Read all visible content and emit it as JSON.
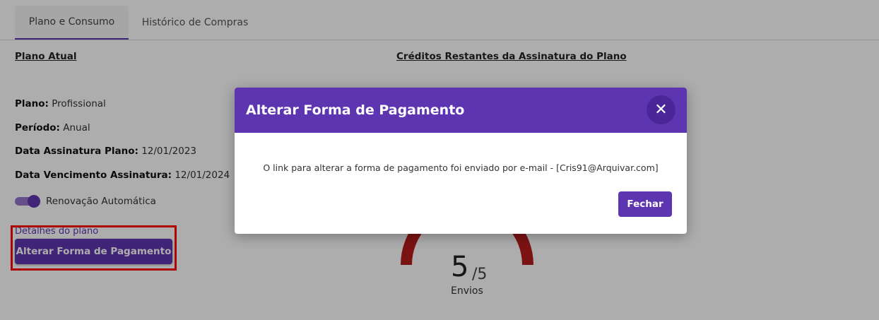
{
  "tabs": [
    {
      "label": "Plano e Consumo",
      "active": true
    },
    {
      "label": "Histórico de Compras",
      "active": false
    }
  ],
  "plan": {
    "heading": "Plano Atual",
    "fields": [
      {
        "label": "Plano:",
        "value": "Profissional"
      },
      {
        "label": "Período:",
        "value": "Anual"
      },
      {
        "label": "Data Assinatura Plano:",
        "value": "12/01/2023"
      },
      {
        "label": "Data Vencimento Assinatura:",
        "value": "12/01/2024"
      }
    ],
    "auto_renew": {
      "label": "Renovação Automática",
      "enabled": true
    },
    "details_link": "Detalhes do plano",
    "change_payment_button": "Alterar Forma de Pagamento"
  },
  "credits": {
    "heading": "Créditos Restantes da Assinatura do Plano",
    "remaining": "5",
    "total": "/5",
    "unit": "Envios"
  },
  "modal": {
    "title": "Alterar Forma de Pagamento",
    "close_icon": "close-icon",
    "message": "O link para alterar a forma de pagamento foi enviado por e-mail - [Cris91@Arquivar.com]",
    "button": "Fechar"
  },
  "colors": {
    "primary": "#5e35b1",
    "highlight": "#ff0000",
    "gauge": "#b71c1c"
  }
}
